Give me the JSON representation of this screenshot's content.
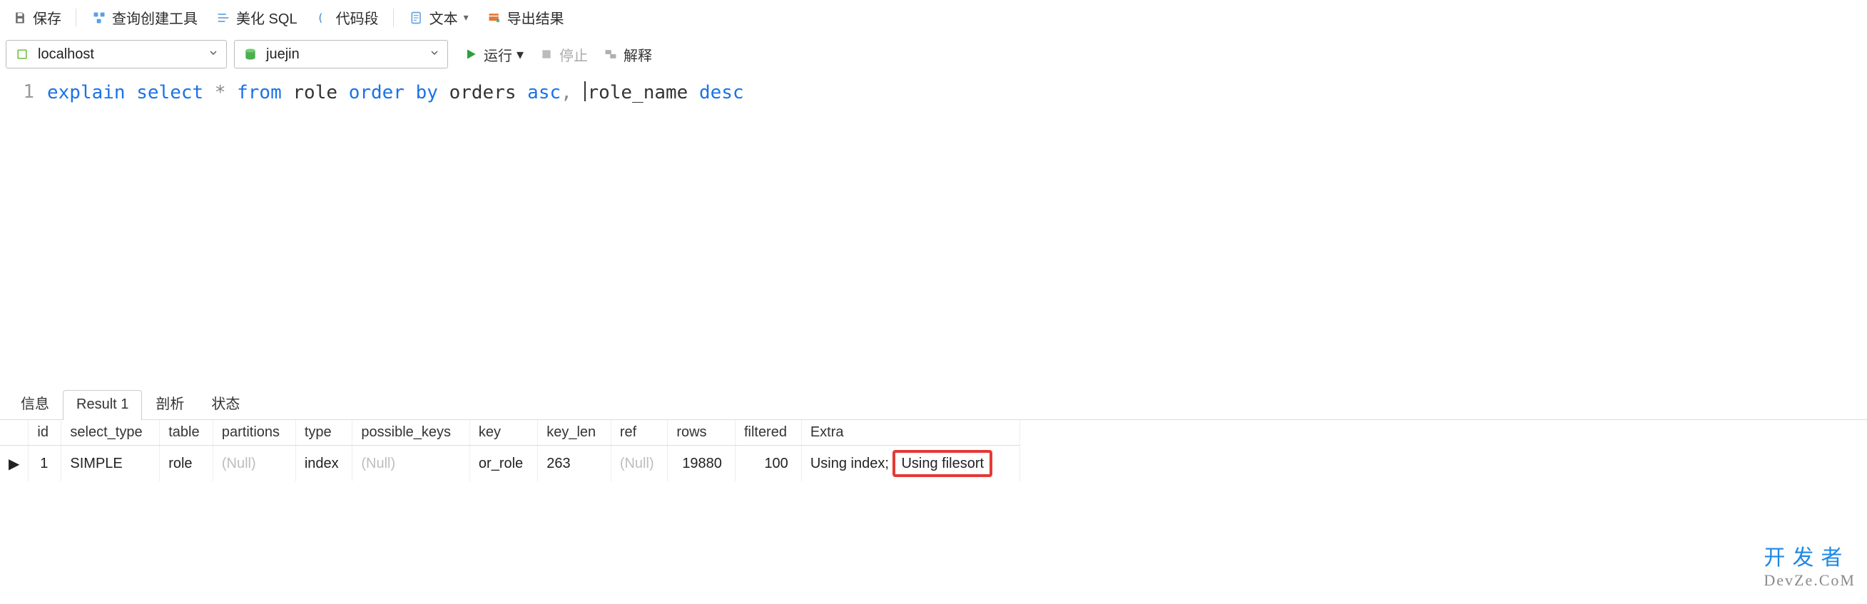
{
  "toolbar": {
    "save": "保存",
    "query_builder": "查询创建工具",
    "beautify": "美化 SQL",
    "code_snip": "代码段",
    "text": "文本",
    "export": "导出结果"
  },
  "runbar": {
    "connection": "localhost",
    "database": "juejin",
    "run": "运行",
    "stop": "停止",
    "explain": "解释"
  },
  "editor": {
    "line_no": "1",
    "tokens": {
      "explain": "explain",
      "select": "select",
      "star": "*",
      "from": "from",
      "role": "role",
      "order": "order",
      "by": "by",
      "orders": "orders",
      "asc": "asc",
      "comma": ",",
      "role_name": "role_name",
      "desc": "desc"
    }
  },
  "tabs": {
    "info": "信息",
    "result1": "Result 1",
    "profile": "剖析",
    "status": "状态"
  },
  "grid": {
    "headers": [
      "id",
      "select_type",
      "table",
      "partitions",
      "type",
      "possible_keys",
      "key",
      "key_len",
      "ref",
      "rows",
      "filtered",
      "Extra"
    ],
    "row": {
      "id": "1",
      "select_type": "SIMPLE",
      "table": "role",
      "partitions": "(Null)",
      "type": "index",
      "possible_keys": "(Null)",
      "key": "or_role",
      "key_len": "263",
      "ref": "(Null)",
      "rows": "19880",
      "filtered": "100",
      "extra_a": "Using index",
      "extra_b": "Using filesort"
    }
  },
  "watermark": {
    "cn": "开发者",
    "en": "DevZe.CoM"
  }
}
